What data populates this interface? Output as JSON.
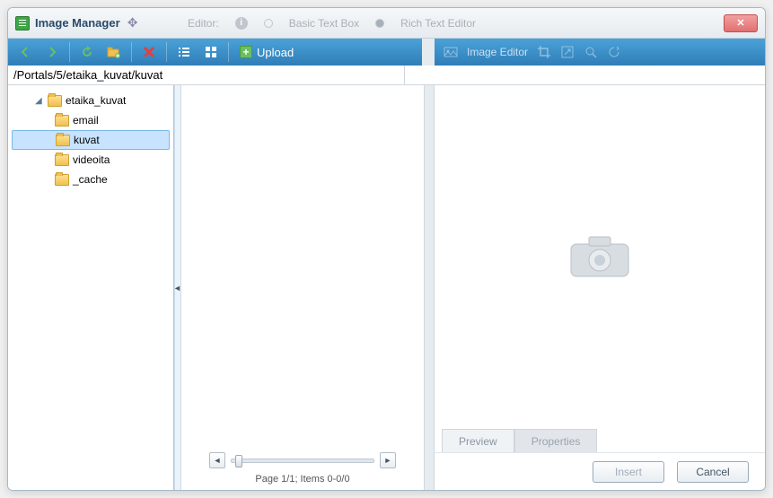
{
  "title": "Image Manager",
  "topbar": {
    "editor_label": "Editor:",
    "basic_label": "Basic Text Box",
    "rich_label": "Rich Text Editor"
  },
  "toolbar": {
    "upload_label": "Upload",
    "image_editor_label": "Image Editor"
  },
  "path": "/Portals/5/etaika_kuvat/kuvat",
  "tree": {
    "root": "etaika_kuvat",
    "children": [
      "email",
      "kuvat",
      "videoita",
      "_cache"
    ],
    "selected": "kuvat"
  },
  "pager": {
    "status": "Page 1/1; Items 0-0/0"
  },
  "tabs": {
    "preview": "Preview",
    "properties": "Properties"
  },
  "buttons": {
    "insert": "Insert",
    "cancel": "Cancel"
  }
}
